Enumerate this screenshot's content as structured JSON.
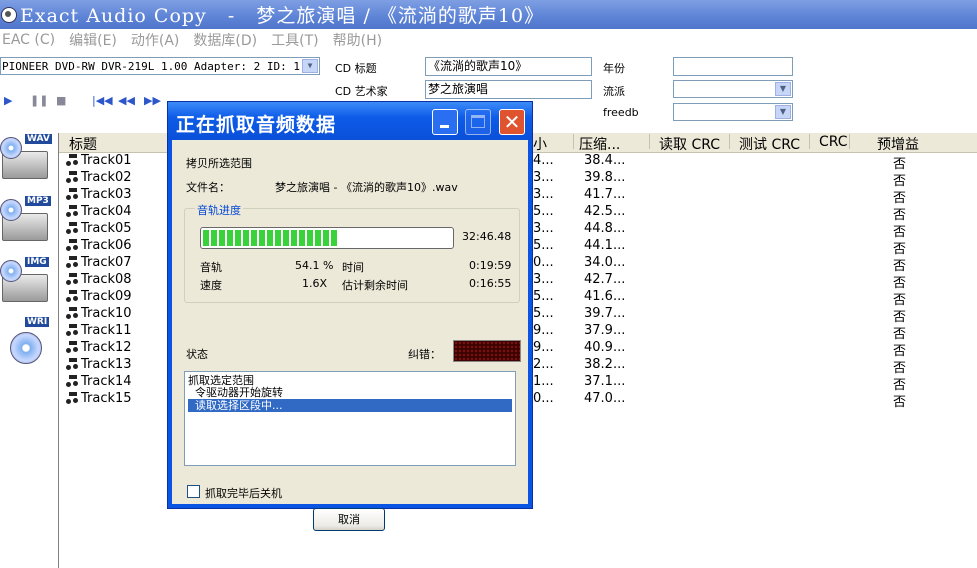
{
  "window": {
    "title": "Exact Audio Copy   -   梦之旅演唱 / 《流淌的歌声10》"
  },
  "menu": [
    "EAC (C)",
    "编辑(E)",
    "动作(A)",
    "数据库(D)",
    "工具(T)",
    "帮助(H)"
  ],
  "drive": {
    "selected": "PIONEER DVD-RW  DVR-219L 1.00  Adapter: 2  ID: 1"
  },
  "metadata": {
    "cd_title_label": "CD 标题",
    "cd_title_value": "《流淌的歌声10》",
    "cd_artist_label": "CD 艺术家",
    "cd_artist_value": "梦之旅演唱",
    "year_label": "年份",
    "year_value": "",
    "genre_label": "流派",
    "freedb_label": "freedb"
  },
  "side_actions": [
    {
      "tag": "WAV"
    },
    {
      "tag": "MP3"
    },
    {
      "tag": "IMG"
    },
    {
      "tag": "WRI"
    }
  ],
  "columns": {
    "title": "标题",
    "size": "小",
    "compressed": "压缩...",
    "read_crc": "读取 CRC",
    "test_crc": "测试 CRC",
    "crc": "CRC",
    "gain": "预增益"
  },
  "tracks": [
    {
      "title": "Track01",
      "size": "4...",
      "comp": "38.4...",
      "gain": "否"
    },
    {
      "title": "Track02",
      "size": "3...",
      "comp": "39.8...",
      "gain": "否"
    },
    {
      "title": "Track03",
      "size": "3...",
      "comp": "41.7...",
      "gain": "否"
    },
    {
      "title": "Track04",
      "size": "5...",
      "comp": "42.5...",
      "gain": "否"
    },
    {
      "title": "Track05",
      "size": "3...",
      "comp": "44.8...",
      "gain": "否"
    },
    {
      "title": "Track06",
      "size": "5...",
      "comp": "44.1...",
      "gain": "否"
    },
    {
      "title": "Track07",
      "size": "0...",
      "comp": "34.0...",
      "gain": "否"
    },
    {
      "title": "Track08",
      "size": "3...",
      "comp": "42.7...",
      "gain": "否"
    },
    {
      "title": "Track09",
      "size": "5...",
      "comp": "41.6...",
      "gain": "否"
    },
    {
      "title": "Track10",
      "size": "5...",
      "comp": "39.7...",
      "gain": "否"
    },
    {
      "title": "Track11",
      "size": "9...",
      "comp": "37.9...",
      "gain": "否"
    },
    {
      "title": "Track12",
      "size": "9...",
      "comp": "40.9...",
      "gain": "否"
    },
    {
      "title": "Track13",
      "size": "2...",
      "comp": "38.2...",
      "gain": "否"
    },
    {
      "title": "Track14",
      "size": "1...",
      "comp": "37.1...",
      "gain": "否"
    },
    {
      "title": "Track15",
      "size": "0...",
      "comp": "47.0...",
      "gain": "否"
    }
  ],
  "dialog": {
    "title": "正在抓取音频数据",
    "copy_range": "拷贝所选范围",
    "filename_label": "文件名：",
    "filename": "梦之旅演唱 - 《流淌的歌声10》.wav",
    "progress_group": "音轨进度",
    "progress_fraction": 0.541,
    "progress_time": "32:46.48",
    "track_label": "音轨",
    "track_percent": "54.1 %",
    "time_label": "时间",
    "time_value": "0:19:59",
    "speed_label": "速度",
    "speed_value": "1.6X",
    "remaining_label": "估计剩余时间",
    "remaining_value": "0:16:55",
    "status_label": "状态",
    "error_label": "纠错：",
    "status_lines": [
      "抓取选定范围",
      "  令驱动器开始旋转",
      "  读取选择区段中..."
    ],
    "shutdown_label": "抓取完毕后关机",
    "cancel": "取消"
  }
}
